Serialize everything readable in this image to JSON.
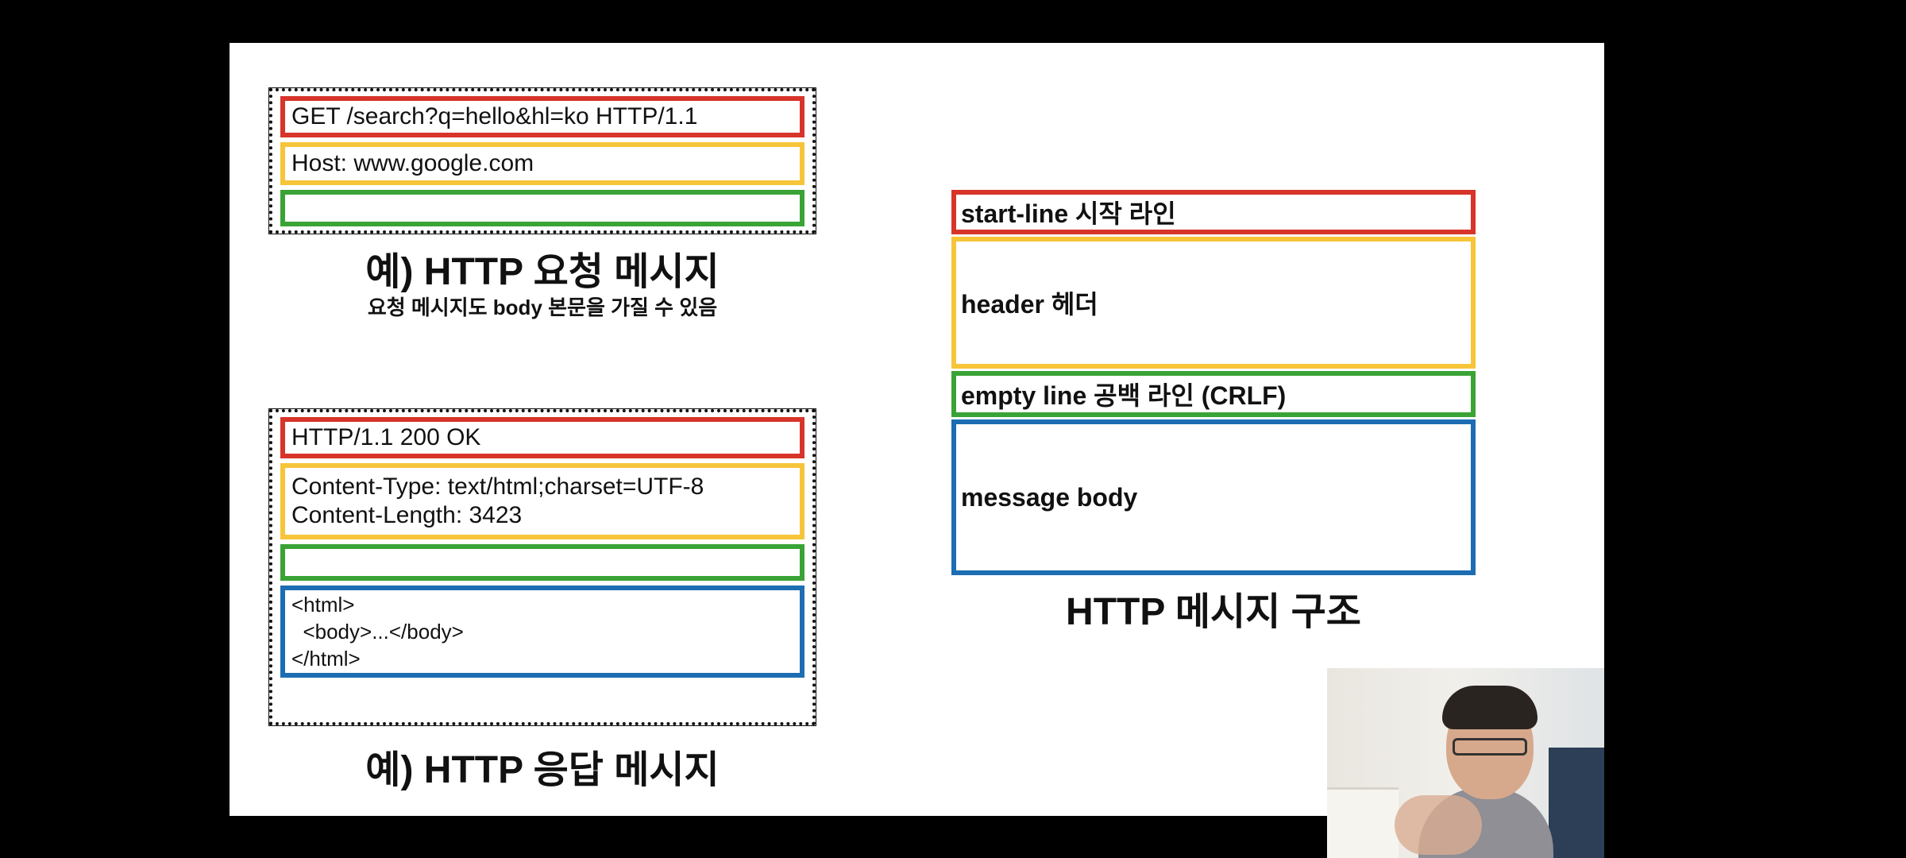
{
  "request_example": {
    "start_line": "GET /search?q=hello&hl=ko HTTP/1.1",
    "header": "Host: www.google.com",
    "empty_line": "",
    "caption": "예) HTTP 요청 메시지",
    "subcaption": "요청 메시지도 body 본문을 가질 수 있음"
  },
  "response_example": {
    "start_line": "HTTP/1.1 200 OK",
    "headers": [
      "Content-Type: text/html;charset=UTF-8",
      "Content-Length: 3423"
    ],
    "empty_line": "",
    "body_lines": [
      "<html>",
      "  <body>...</body>",
      "</html>"
    ],
    "caption": "예) HTTP 응답 메시지"
  },
  "structure": {
    "start_line": "start-line 시작 라인",
    "header": "header 헤더",
    "empty_line": "empty line 공백 라인 (CRLF)",
    "message_body": "message body",
    "caption": "HTTP 메시지 구조"
  },
  "colors": {
    "start_line": "#d7342a",
    "header": "#f6c53a",
    "empty_line": "#3aa336",
    "body": "#1c6db2"
  },
  "webcam": {
    "icon": "presenter-video-feed"
  }
}
